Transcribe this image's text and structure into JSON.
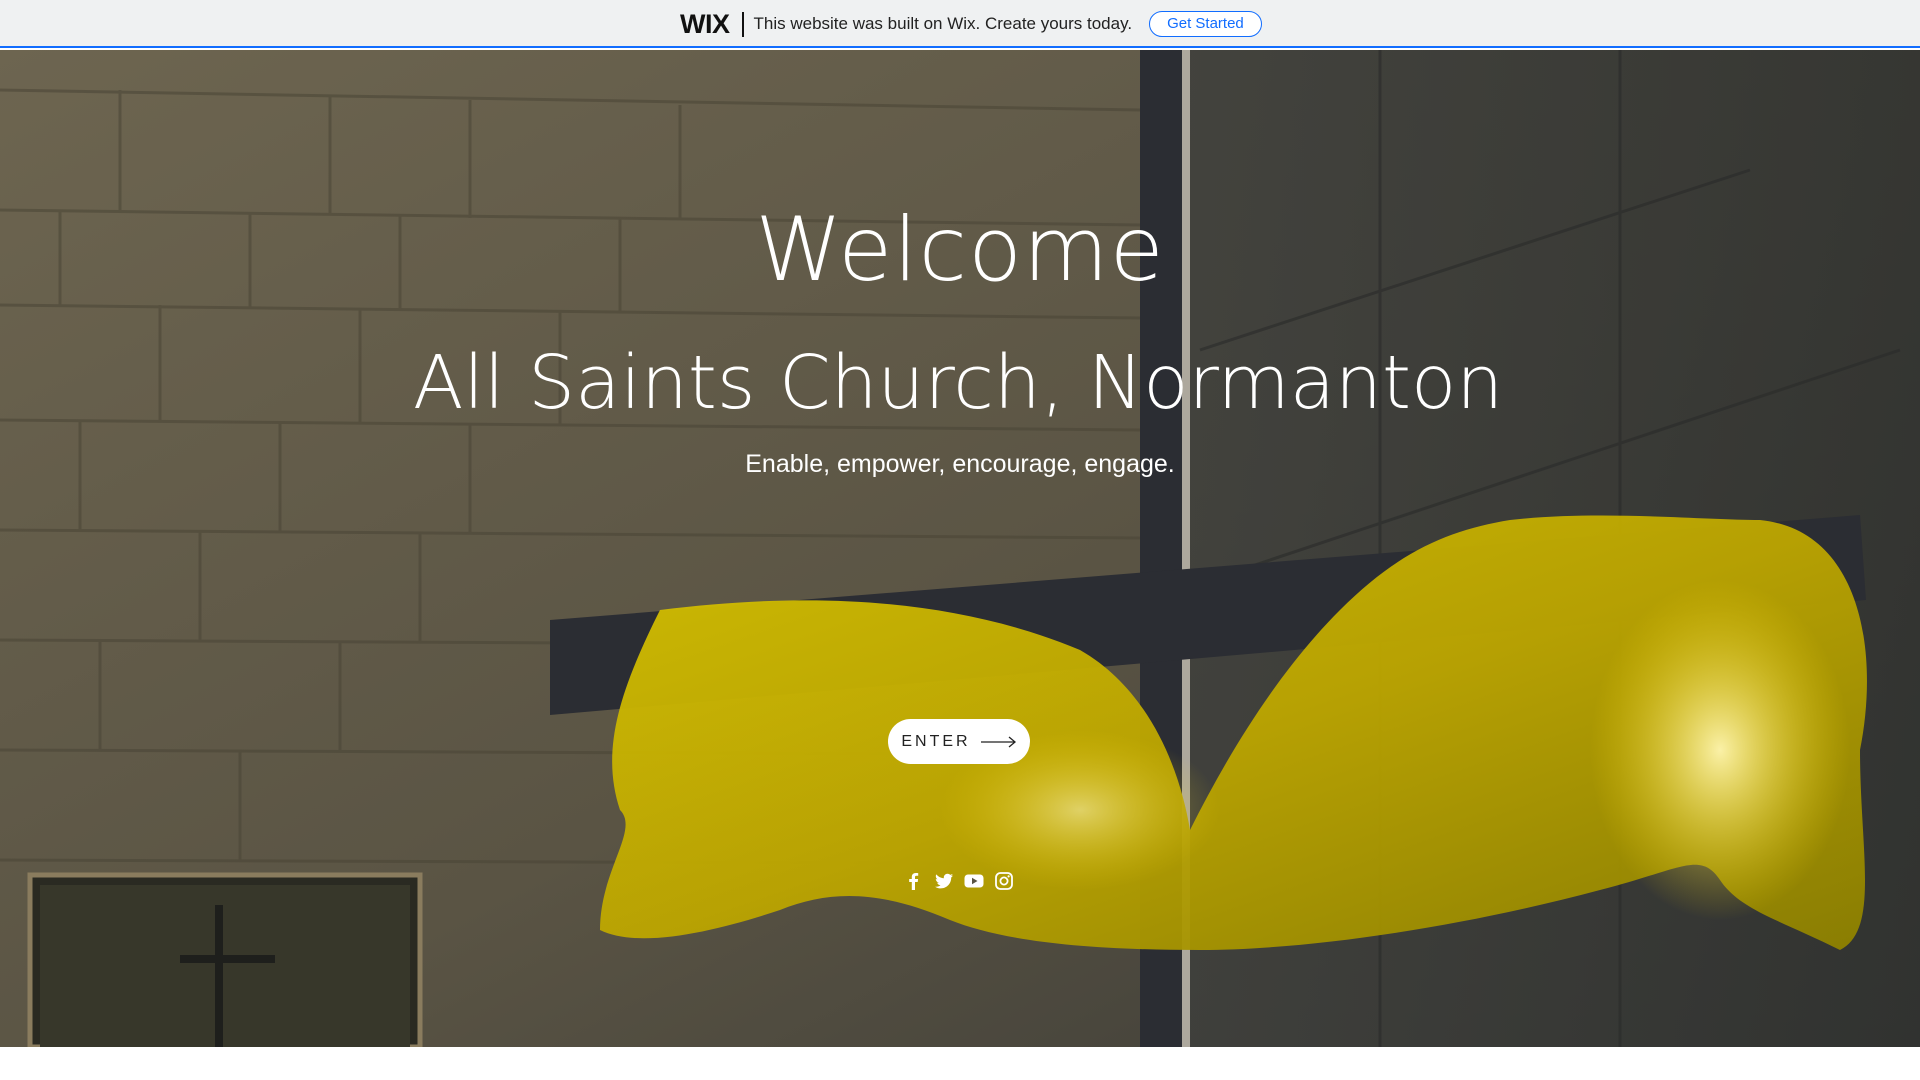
{
  "wix_banner": {
    "logo": "WIX",
    "message": "This website was built on Wix. Create yours today.",
    "cta_label": "Get Started",
    "accent": "#116dff"
  },
  "hero": {
    "welcome": "Welcome",
    "church_name": "All Saints Church, Normanton",
    "tagline": "Enable, empower, encourage, engage.",
    "enter_label": "ENTER",
    "social_icons": [
      "facebook-icon",
      "twitter-icon",
      "youtube-icon",
      "instagram-icon"
    ]
  },
  "colors": {
    "cloth": "#e6d200",
    "stone": "#6f6650",
    "cross": "#2b2d33"
  }
}
